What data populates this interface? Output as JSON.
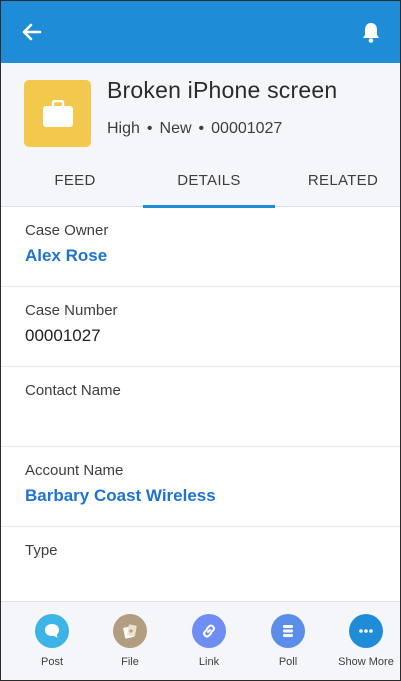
{
  "colors": {
    "header_blue": "#1f8cd7",
    "case_icon_yellow": "#f2c94c",
    "link_blue": "#1f74cf",
    "post": "#3cb4e6",
    "file": "#b29d7f",
    "link": "#6f8ef3",
    "poll": "#5b8ee8",
    "show_more": "#1f8cd7"
  },
  "topbar": {
    "back_icon": "arrow-left-icon",
    "notification_icon": "bell-icon"
  },
  "record": {
    "icon": "briefcase-icon",
    "title": "Broken iPhone screen",
    "priority": "High",
    "status": "New",
    "case_number": "00001027",
    "separator": "•"
  },
  "tabs": [
    {
      "label": "FEED",
      "active": false
    },
    {
      "label": "DETAILS",
      "active": true
    },
    {
      "label": "RELATED",
      "active": false
    }
  ],
  "fields": [
    {
      "label": "Case Owner",
      "value": "Alex Rose",
      "is_link": true
    },
    {
      "label": "Case Number",
      "value": "00001027",
      "is_link": false
    },
    {
      "label": "Contact Name",
      "value": "",
      "is_link": false
    },
    {
      "label": "Account Name",
      "value": "Barbary Coast Wireless",
      "is_link": true
    },
    {
      "label": "Type",
      "value": "",
      "is_link": false
    }
  ],
  "actions": [
    {
      "label": "Post",
      "icon": "chat-bubble-icon"
    },
    {
      "label": "File",
      "icon": "file-icon"
    },
    {
      "label": "Link",
      "icon": "link-icon"
    },
    {
      "label": "Poll",
      "icon": "poll-icon"
    },
    {
      "label": "Show More",
      "icon": "more-icon"
    }
  ]
}
